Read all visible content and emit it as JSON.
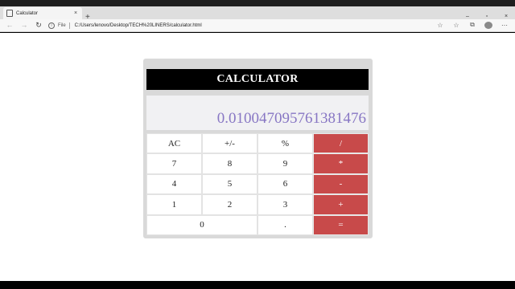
{
  "browser": {
    "tab_title": "Calculator",
    "tab_close": "×",
    "new_tab": "+",
    "window_controls": [
      "–",
      "▫",
      "×"
    ],
    "nav": {
      "back": "←",
      "forward": "→",
      "reload": "↻"
    },
    "info": "i",
    "file_label": "File",
    "url": "C:/Users/lenovo/Desktop/TECH%20LINERS/calculator.html",
    "tools": [
      "☆",
      "☆",
      "⧉"
    ]
  },
  "calculator": {
    "title": "CALCULATOR",
    "display": "0.010047095761381476",
    "keys": [
      {
        "label": "AC",
        "type": "fn"
      },
      {
        "label": "+/-",
        "type": "fn"
      },
      {
        "label": "%",
        "type": "fn"
      },
      {
        "label": "/",
        "type": "op"
      },
      {
        "label": "7",
        "type": "num"
      },
      {
        "label": "8",
        "type": "num"
      },
      {
        "label": "9",
        "type": "num"
      },
      {
        "label": "*",
        "type": "op"
      },
      {
        "label": "4",
        "type": "num"
      },
      {
        "label": "5",
        "type": "num"
      },
      {
        "label": "6",
        "type": "num"
      },
      {
        "label": "-",
        "type": "op"
      },
      {
        "label": "1",
        "type": "num"
      },
      {
        "label": "2",
        "type": "num"
      },
      {
        "label": "3",
        "type": "num"
      },
      {
        "label": "+",
        "type": "op"
      },
      {
        "label": "0",
        "type": "num"
      },
      {
        "label": ".",
        "type": "num"
      },
      {
        "label": "=",
        "type": "op"
      }
    ]
  },
  "colors": {
    "operator_bg": "#c84a4a",
    "display_text": "#8877c4",
    "title_bg": "#000000"
  }
}
